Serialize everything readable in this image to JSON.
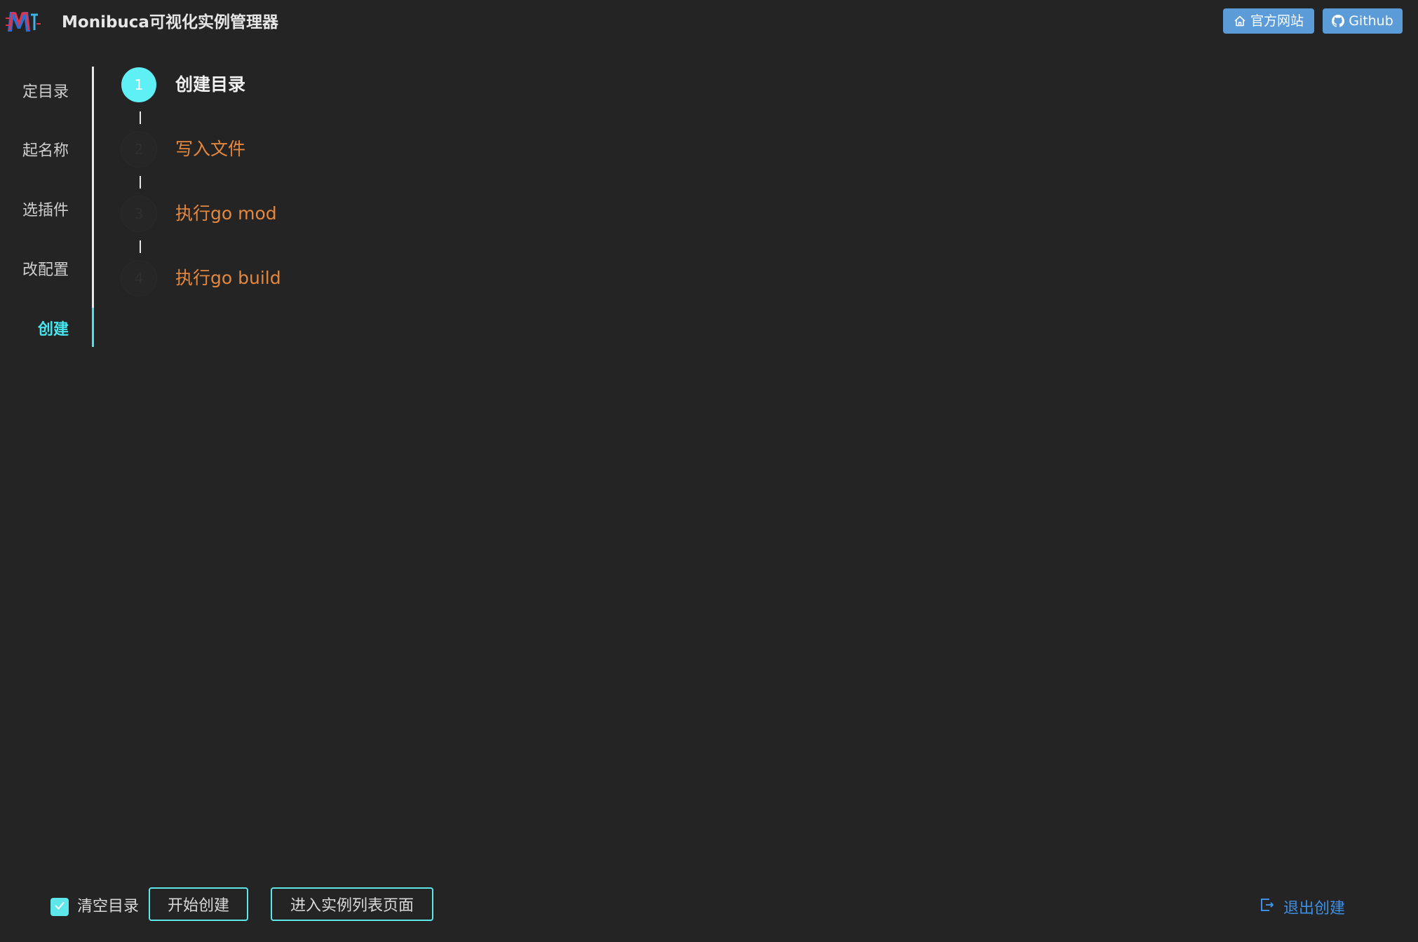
{
  "header": {
    "title": "Monibuca可视化实例管理器",
    "buttons": {
      "website_label": "官方网站",
      "github_label": "Github"
    }
  },
  "sidenav": {
    "items": [
      {
        "label": "定目录",
        "active": false
      },
      {
        "label": "起名称",
        "active": false
      },
      {
        "label": "选插件",
        "active": false
      },
      {
        "label": "改配置",
        "active": false
      },
      {
        "label": "创建",
        "active": true
      }
    ]
  },
  "steps": [
    {
      "number": "1",
      "label": "创建目录",
      "status": "active"
    },
    {
      "number": "2",
      "label": "写入文件",
      "status": "pending"
    },
    {
      "number": "3",
      "label": "执行go mod",
      "status": "pending"
    },
    {
      "number": "4",
      "label": "执行go build",
      "status": "pending"
    }
  ],
  "footer": {
    "clear_dir": {
      "label": "清空目录",
      "checked": true
    },
    "start_label": "开始创建",
    "list_label": "进入实例列表页面",
    "exit_label": "退出创建"
  },
  "colors": {
    "background": "#242424",
    "accent_cyan": "#47e6ef",
    "pending_orange": "#e5873d",
    "header_button_blue": "#5a9bd8",
    "link_blue": "#3d8fe8"
  },
  "icons": {
    "logo": "monibuca-logo",
    "website": "home-icon",
    "github": "github-icon",
    "checkbox": "check-icon",
    "exit": "logout-icon"
  }
}
